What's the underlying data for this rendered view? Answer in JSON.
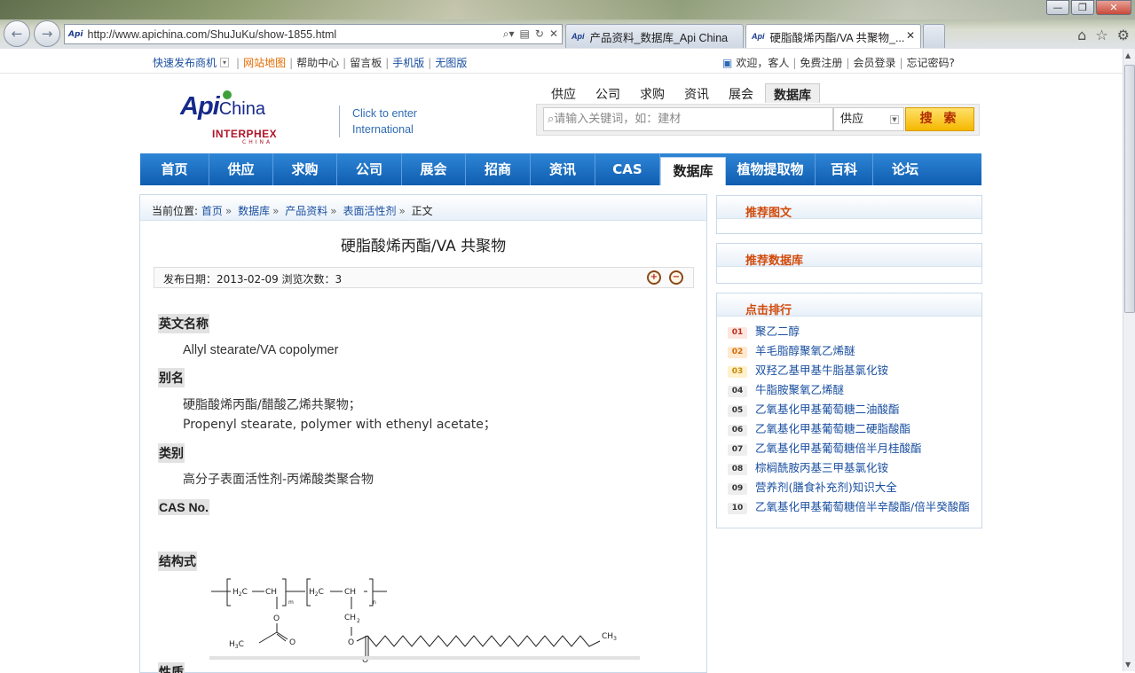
{
  "browser": {
    "url": "http://www.apichina.com/ShuJuKu/show-1855.html",
    "tabs": [
      {
        "label": "产品资料_数据库_Api China"
      },
      {
        "label": "硬脂酸烯丙酯/VA 共聚物_..."
      }
    ],
    "fav_text": "Api"
  },
  "topbar": {
    "links": [
      "快速发布商机",
      "网站地图",
      "帮助中心",
      "留言板",
      "手机版",
      "无图版"
    ],
    "welcome": "欢迎，客人",
    "right_links": [
      "免费注册",
      "会员登录",
      "忘记密码?"
    ]
  },
  "logo": {
    "api": "Api",
    "china": "China",
    "interphex": "INTERPHEX",
    "cn": "CHINA"
  },
  "enter": {
    "line1": "Click to enter",
    "line2": "International"
  },
  "search": {
    "tabs": [
      "供应",
      "公司",
      "求购",
      "资讯",
      "展会",
      "数据库"
    ],
    "active_tab": "数据库",
    "placeholder": "请输入关键词，如：建材",
    "select_value": "供应",
    "button": "搜 索"
  },
  "mainnav": [
    "首页",
    "供应",
    "求购",
    "公司",
    "展会",
    "招商",
    "资讯",
    "CAS",
    "数据库",
    "植物提取物",
    "百科",
    "论坛"
  ],
  "breadcrumb": {
    "label": "当前位置:",
    "items": [
      "首页",
      "数据库",
      "产品资料",
      "表面活性剂"
    ],
    "current": "正文"
  },
  "article": {
    "title": "硬脂酸烯丙酯/VA 共聚物",
    "meta": "发布日期：2013-02-09  浏览次数：3",
    "sections": {
      "en_name_label": "英文名称",
      "en_name": "Allyl stearate/VA copolymer",
      "alias_label": "别名",
      "alias_1": "硬脂酸烯丙酯/醋酸乙烯共聚物；",
      "alias_2": "Propenyl stearate, polymer with ethenyl acetate；",
      "category_label": "类别",
      "category": "高分子表面活性剂-丙烯酸类聚合物",
      "cas_label": "CAS No.",
      "structure_label": "结构式",
      "next_label": "性质"
    }
  },
  "sidebar": {
    "recommend_pics": "推荐图文",
    "recommend_db": "推荐数据库",
    "ranking": "点击排行",
    "items": [
      {
        "n": "01",
        "t": "聚乙二醇"
      },
      {
        "n": "02",
        "t": "羊毛脂醇聚氧乙烯醚"
      },
      {
        "n": "03",
        "t": "双羟乙基甲基牛脂基氯化铵"
      },
      {
        "n": "04",
        "t": "牛脂胺聚氧乙烯醚"
      },
      {
        "n": "05",
        "t": "乙氧基化甲基葡萄糖二油酸酯"
      },
      {
        "n": "06",
        "t": "乙氧基化甲基葡萄糖二硬脂酸酯"
      },
      {
        "n": "07",
        "t": "乙氧基化甲基葡萄糖倍半月桂酸酯"
      },
      {
        "n": "08",
        "t": "棕榈酰胺丙基三甲基氯化铵"
      },
      {
        "n": "09",
        "t": "营养剂(膳食补充剂)知识大全"
      },
      {
        "n": "10",
        "t": "乙氧基化甲基葡萄糖倍半辛酸酯/倍半癸酸酯"
      }
    ]
  }
}
